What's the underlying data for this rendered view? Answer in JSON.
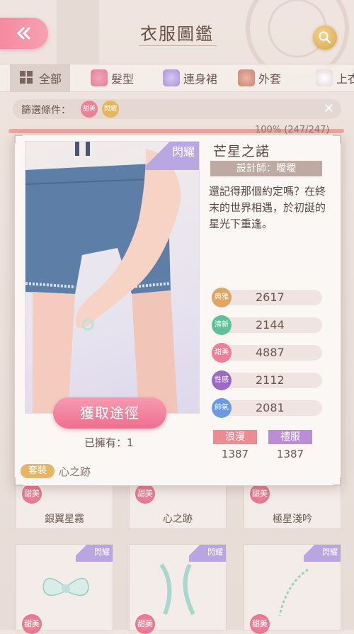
{
  "header": {
    "title": "衣服圖鑑",
    "back_icon": "back-arrow-icon",
    "search_icon": "search-icon"
  },
  "tabs": [
    {
      "label": "全部",
      "icon": "grid-icon",
      "active": true
    },
    {
      "label": "髮型",
      "icon": "hair-icon",
      "active": false
    },
    {
      "label": "連身裙",
      "icon": "dress-icon",
      "active": false
    },
    {
      "label": "外套",
      "icon": "coat-icon",
      "active": false
    },
    {
      "label": "上衣",
      "icon": "top-icon",
      "active": false
    }
  ],
  "filter": {
    "label": "篩選條件：",
    "tags": [
      {
        "text": "甜美",
        "color": "#ee7f98"
      },
      {
        "text": "閃耀",
        "color": "#e6b65e"
      }
    ]
  },
  "progress": {
    "text": "100% (247/247)",
    "fraction": 1.0
  },
  "grid": {
    "row1": [
      {
        "name": "銀翼星霧",
        "badge": "甜美"
      },
      {
        "name": "心之跡",
        "badge": "甜美"
      },
      {
        "name": "極星淺吟",
        "badge": "甜美"
      }
    ],
    "row2": [
      {
        "badge": "甜美",
        "corner": "閃耀"
      },
      {
        "badge": "甜美",
        "corner": "閃耀"
      },
      {
        "badge": "甜美",
        "corner": "閃耀"
      }
    ]
  },
  "detail": {
    "image_corner": "閃耀",
    "name": "芒星之諾",
    "designer": "設計師：曖曖",
    "description": "還記得那個約定嗎？在終末的世界相遇，於初誕的星光下重逢。",
    "acquire_label": "獲取途徑",
    "owned": "已擁有：1",
    "stats": [
      {
        "label": "典雅",
        "value": "2617",
        "color": "#e3a363"
      },
      {
        "label": "清新",
        "value": "2144",
        "color": "#5ec19a"
      },
      {
        "label": "甜美",
        "value": "4887",
        "color": "#ef7f98"
      },
      {
        "label": "性感",
        "value": "2112",
        "color": "#9a6ac6"
      },
      {
        "label": "帥氣",
        "value": "2081",
        "color": "#6a9be0"
      }
    ],
    "tags": [
      {
        "label": "浪漫",
        "value": "1387",
        "color": "#ec8b92"
      },
      {
        "label": "禮服",
        "value": "1387",
        "color": "#b98ed4"
      }
    ],
    "set_tag": "套裝",
    "set_name": "心之跡"
  }
}
